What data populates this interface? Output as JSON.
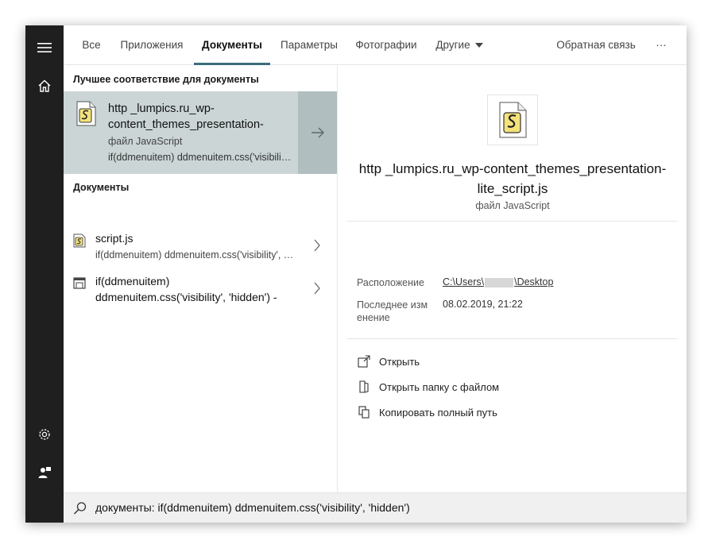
{
  "tabs": [
    {
      "label": "Все"
    },
    {
      "label": "Приложения"
    },
    {
      "label": "Документы"
    },
    {
      "label": "Параметры"
    },
    {
      "label": "Фотографии"
    },
    {
      "label": "Другие"
    },
    {
      "label": "Обратная связь"
    },
    {
      "label": "···"
    }
  ],
  "active_tab": "Документы",
  "best_match": {
    "section_title": "Лучшее соответствие для документы",
    "title": "http _lumpics.ru_wp-content_themes_presentation-",
    "type": "файл JavaScript",
    "snippet": "if(ddmenuitem) ddmenuitem.css('visibility', 'hidden')",
    "icon": "script-file-icon"
  },
  "documents": {
    "section_title": "Документы",
    "items": [
      {
        "title": "script.js",
        "subtitle": "if(ddmenuitem) ddmenuitem.css('visibility', 'hidden')",
        "icon": "script-file-icon"
      },
      {
        "title": "if(ddmenuitem)",
        "subtitle": "ddmenuitem.css('visibility', 'hidden') -",
        "icon": "document-file-icon"
      }
    ]
  },
  "preview": {
    "title": "http _lumpics.ru_wp-content_themes_presentation-lite_script.js",
    "type": "файл JavaScript",
    "location_label": "Расположение",
    "location_prefix": "C:\\Users\\",
    "location_suffix": "\\Desktop",
    "modified_label": "Последнее изм енение",
    "modified_value": "08.02.2019, 21:22",
    "actions": [
      {
        "label": "Открыть",
        "icon": "open-icon"
      },
      {
        "label": "Открыть папку с файлом",
        "icon": "folder-icon"
      },
      {
        "label": "Копировать полный путь",
        "icon": "copy-icon"
      }
    ]
  },
  "search": {
    "query": "документы: if(ddmenuitem) ddmenuitem.css('visibility', 'hidden')"
  },
  "colors": {
    "rail": "#1f1f1f",
    "best_match_bg": "#cbd5d6",
    "best_match_arrow_bg": "#b0bec0",
    "active_tab_underline": "#3a6e7c",
    "search_bar_bg": "#f0f0f0"
  }
}
